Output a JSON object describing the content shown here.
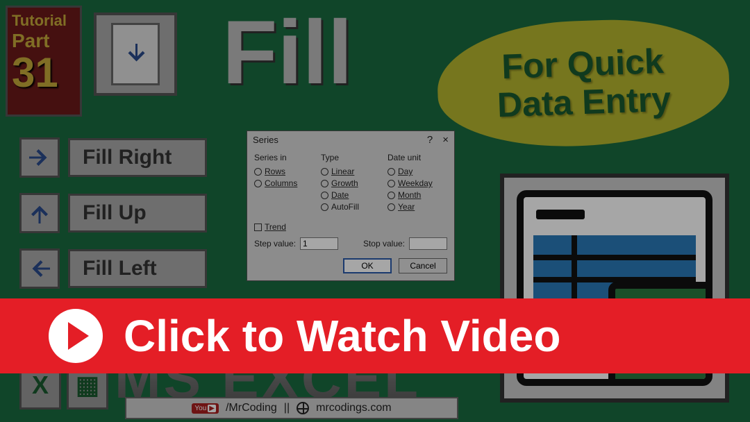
{
  "badge": {
    "line1": "Tutorial",
    "line2": "Part",
    "number": "31"
  },
  "title": "Fill",
  "blob": {
    "line1": "For Quick",
    "line2": "Data Entry"
  },
  "fill_options": {
    "right": "Fill Right",
    "up": "Fill Up",
    "left": "Fill Left"
  },
  "dialog": {
    "title": "Series",
    "help": "?",
    "close": "×",
    "cols": {
      "series_in": {
        "header": "Series in",
        "rows": "Rows",
        "columns": "Columns"
      },
      "type": {
        "header": "Type",
        "linear": "Linear",
        "growth": "Growth",
        "date": "Date",
        "autofill": "AutoFill"
      },
      "date_unit": {
        "header": "Date unit",
        "day": "Day",
        "weekday": "Weekday",
        "month": "Month",
        "year": "Year"
      }
    },
    "trend": "Trend",
    "step_label": "Step value:",
    "step_value": "1",
    "stop_label": "Stop value:",
    "stop_value": "",
    "ok": "OK",
    "cancel": "Cancel"
  },
  "ms_excel": "MS EXCEL",
  "footer": {
    "youtube_prefix": "YouTube",
    "channel": "/MrCoding",
    "sep": "||",
    "site": "mrcodings.com"
  },
  "cta": "Click to Watch Video"
}
